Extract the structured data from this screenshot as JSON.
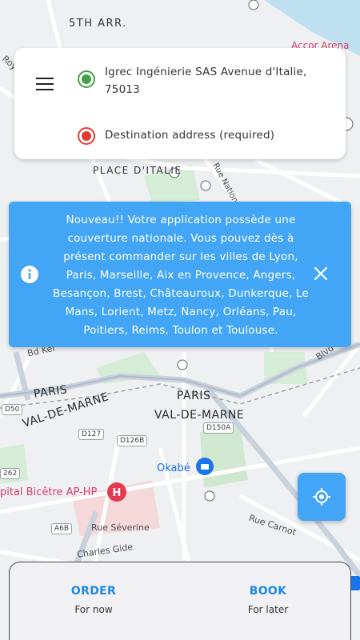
{
  "map": {
    "labels": {
      "arr5": "5TH ARR.",
      "accor": "Accor Arena",
      "place_italie": "PLACE D'ITALIE",
      "ave_nationale": "Rue Nationale",
      "bd_kell": "Bd Kel",
      "bd_vincent": "Blvd",
      "paris_left": "PARIS",
      "vdm_left": "VAL-DE-MARNE",
      "paris_mid": "PARIS",
      "vdm_mid": "VAL-DE-MARNE",
      "okabe": "Okabé",
      "hospital": "pital Bicêtre AP-HP",
      "rue_severine": "Rue Séverine",
      "rue_carnot": "Rue Carnot",
      "charles_gide": "Charles Gide",
      "roy": "Roy",
      "d50": "D50",
      "d127": "D127",
      "d126b": "D126B",
      "d150a": "D150A",
      "r262": "262",
      "a6b": "A6B"
    }
  },
  "address": {
    "origin": "Igrec Ingénierie SAS Avenue d'Italie, 75013",
    "destination_placeholder": "Destination address (required)"
  },
  "banner": {
    "message": "Nouveau!! Votre application possède une couverture nationale. Vous pouvez dès à présent commander sur les villes de Lyon, Paris, Marseille, Aix en Provence, Angers, Besançon, Brest, Châteauroux, Dunkerque, Le Mans, Lorient, Metz, Nancy, Orléans, Pau, Poitiers, Reims, Toulon et Toulouse."
  },
  "actions": {
    "order": {
      "title": "ORDER",
      "subtitle": "For now"
    },
    "book": {
      "title": "BOOK",
      "subtitle": "For later"
    }
  },
  "colors": {
    "accent": "#42a5f5",
    "action_text": "#1e88e5",
    "origin": "#43a047",
    "destination": "#e53935"
  },
  "icons": [
    "menu-icon",
    "origin-marker-icon",
    "destination-marker-icon",
    "info-icon",
    "close-icon",
    "locate-icon"
  ]
}
